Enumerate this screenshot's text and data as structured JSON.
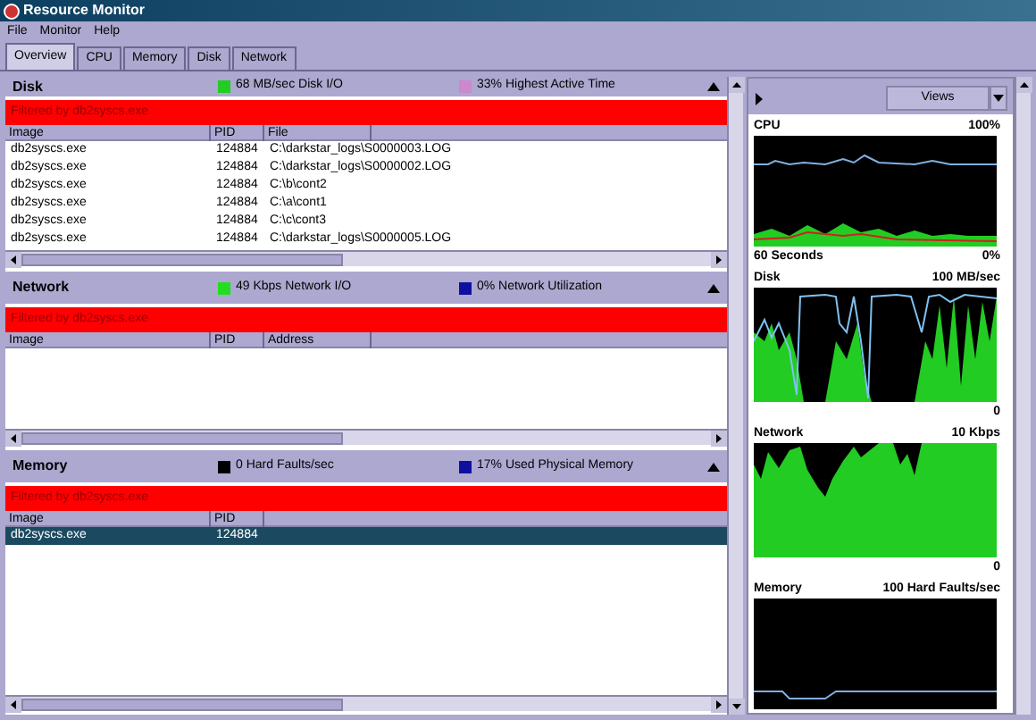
{
  "window": {
    "title": "Resource Monitor"
  },
  "menu": [
    {
      "label": "File"
    },
    {
      "label": "Monitor"
    },
    {
      "label": "Help"
    }
  ],
  "tabs": [
    {
      "label": "Overview",
      "selected": true
    },
    {
      "label": "CPU",
      "selected": false
    },
    {
      "label": "Memory",
      "selected": false
    },
    {
      "label": "Disk",
      "selected": false
    },
    {
      "label": "Network",
      "selected": false
    }
  ],
  "sections": [
    {
      "title": "Disk",
      "stats": [
        {
          "text": "68 MB/sec Disk I/O",
          "color": "#22cc22"
        },
        {
          "text": "33% Highest Active Time",
          "color": "#cc88cc"
        }
      ],
      "filter": "Filtered by db2syscs.exe",
      "columns": [
        "Image",
        "PID",
        "File"
      ],
      "rows": [
        {
          "cells": [
            "db2syscs.exe",
            "124884",
            "C:\\darkstar_logs\\S0000003.LOG"
          ],
          "selected": false
        },
        {
          "cells": [
            "db2syscs.exe",
            "124884",
            "C:\\darkstar_logs\\S0000002.LOG"
          ],
          "selected": false
        },
        {
          "cells": [
            "db2syscs.exe",
            "124884",
            "C:\\b\\cont2"
          ],
          "selected": false
        },
        {
          "cells": [
            "db2syscs.exe",
            "124884",
            "C:\\a\\cont1"
          ],
          "selected": false
        },
        {
          "cells": [
            "db2syscs.exe",
            "124884",
            "C:\\c\\cont3"
          ],
          "selected": false
        },
        {
          "cells": [
            "db2syscs.exe",
            "124884",
            "C:\\darkstar_logs\\S0000005.LOG"
          ],
          "selected": false
        }
      ]
    },
    {
      "title": "Network",
      "stats": [
        {
          "text": "49 Kbps Network I/O",
          "color": "#22dd22"
        },
        {
          "text": "0% Network Utilization",
          "color": "#1010a0"
        }
      ],
      "filter": "Filtered by db2syscs.exe",
      "columns": [
        "Image",
        "PID",
        "Address"
      ]
    },
    {
      "title": "Memory",
      "stats": [
        {
          "text": "0 Hard Faults/sec",
          "color": "#000000"
        },
        {
          "text": "17% Used Physical Memory",
          "color": "#1010a0"
        }
      ],
      "filter": "Filtered by db2syscs.exe",
      "columns": [
        "Image",
        "PID"
      ],
      "rows": [
        {
          "cells": [
            "db2syscs.exe",
            "124884"
          ],
          "selected": true
        }
      ]
    }
  ],
  "views_button": "Views",
  "graphs": [
    {
      "title": "CPU",
      "max": "100%",
      "time": "60 Seconds",
      "min": "0%"
    },
    {
      "title": "Disk",
      "max": "100 MB/sec",
      "min": "0"
    },
    {
      "title": "Network",
      "max": "10 Kbps",
      "min": "0"
    },
    {
      "title": "Memory",
      "max": "100 Hard Faults/sec"
    }
  ]
}
